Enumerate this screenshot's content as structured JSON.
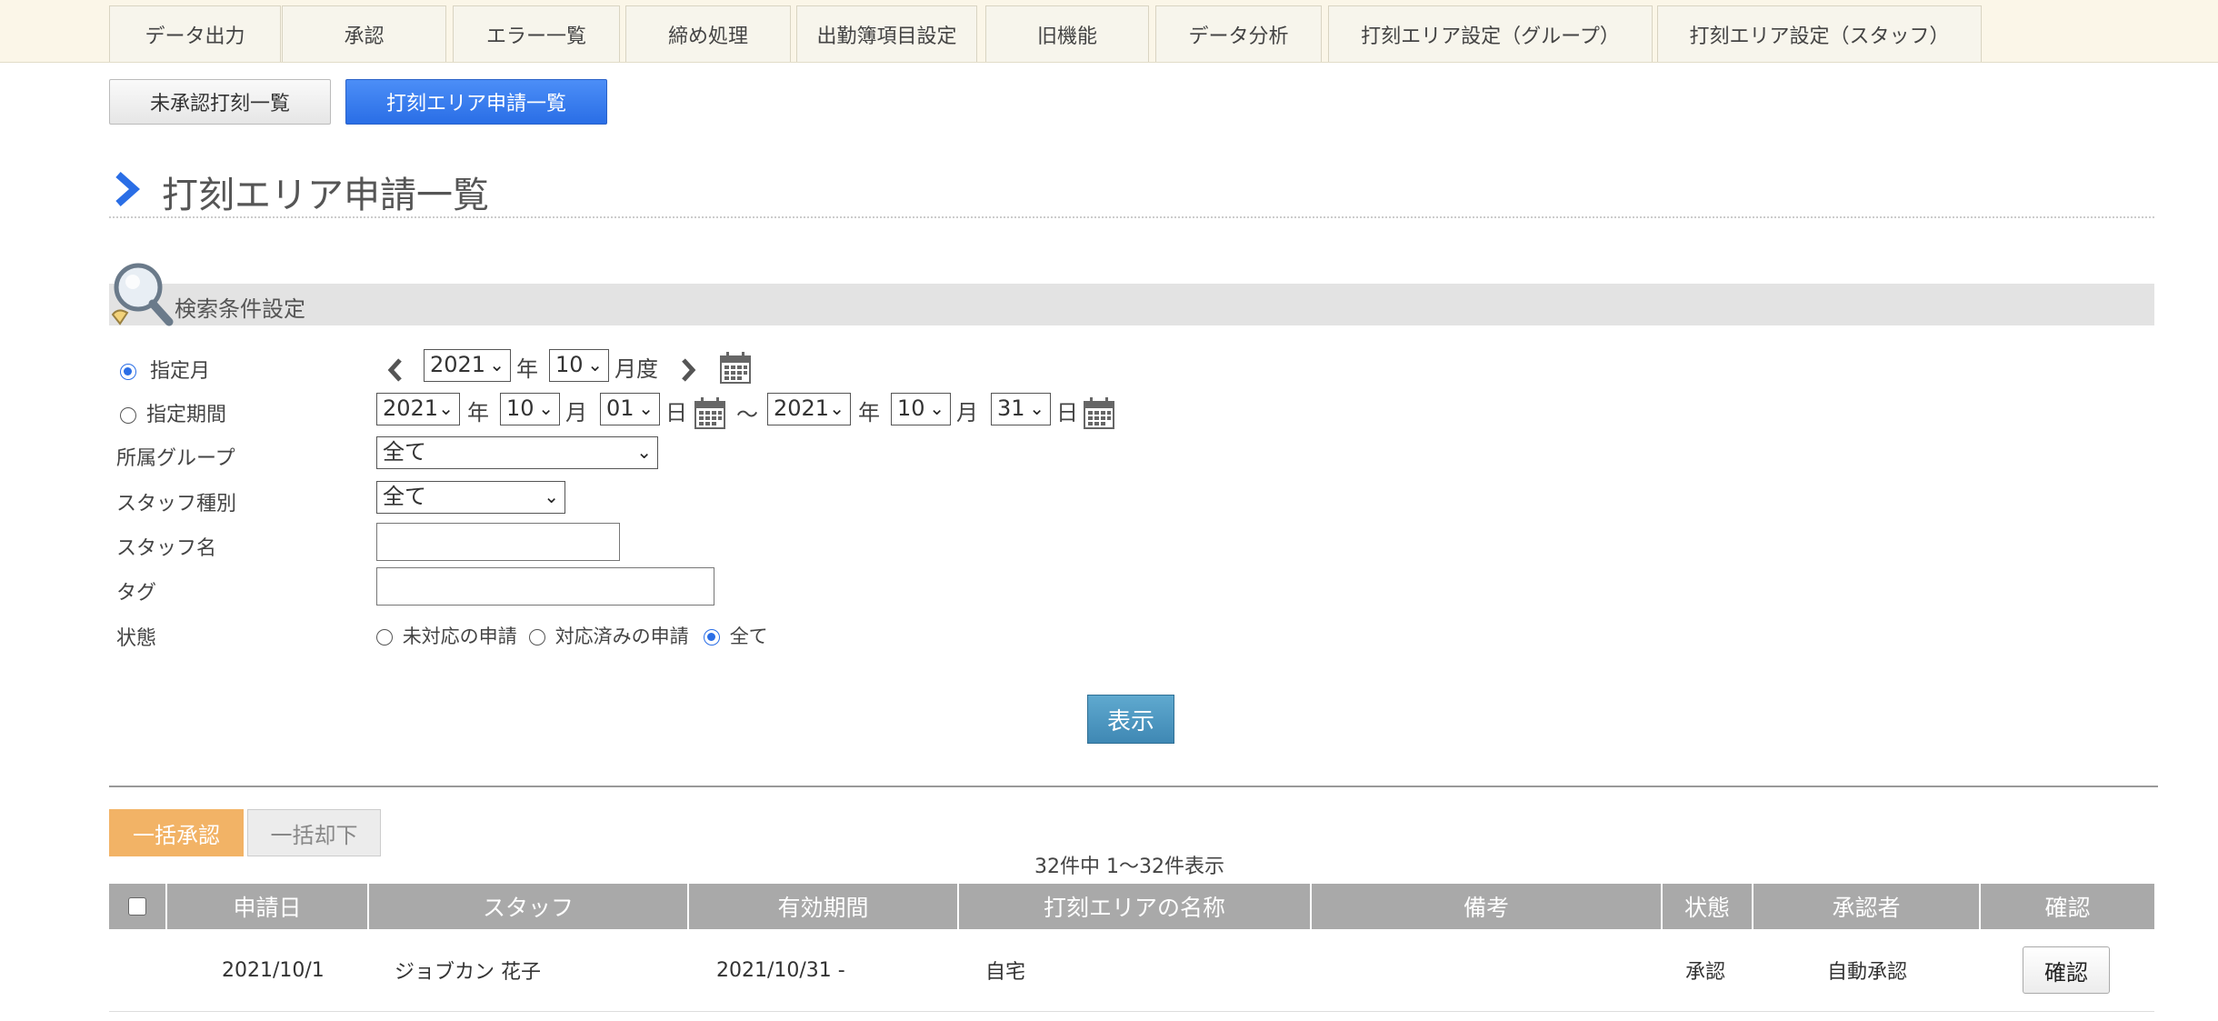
{
  "top_tabs": [
    "データ出力",
    "承認",
    "エラー一覧",
    "締め処理",
    "出勤簿項目設定",
    "旧機能",
    "データ分析",
    "打刻エリア設定（グループ）",
    "打刻エリア設定（スタッフ）"
  ],
  "sub_tabs": {
    "unapproved": "未承認打刻一覧",
    "area_requests": "打刻エリア申請一覧"
  },
  "page_title": "打刻エリア申請一覧",
  "search": {
    "title": "検索条件設定",
    "month_label": "指定月",
    "period_label": "指定期間",
    "month": {
      "year": "2021",
      "year_unit": "年",
      "month": "10",
      "month_unit": "月度"
    },
    "period": {
      "from": {
        "year": "2021",
        "month": "10",
        "day": "01"
      },
      "to": {
        "year": "2021",
        "month": "10",
        "day": "31"
      },
      "year_unit": "年",
      "month_unit": "月",
      "day_unit": "日",
      "tilde": "～"
    },
    "group_label": "所属グループ",
    "group_value": "全て",
    "staff_type_label": "スタッフ種別",
    "staff_type_value": "全て",
    "staff_name_label": "スタッフ名",
    "staff_name_value": "",
    "tag_label": "タグ",
    "tag_value": "",
    "status_label": "状態",
    "status_options": [
      "未対応の申請",
      "対応済みの申請",
      "全て"
    ],
    "status_selected": "全て",
    "show_button": "表示"
  },
  "bulk": {
    "approve": "一括承認",
    "reject": "一括却下"
  },
  "result_count": "32件中 1〜32件表示",
  "table": {
    "headers": [
      "申請日",
      "スタッフ",
      "有効期間",
      "打刻エリアの名称",
      "備考",
      "状態",
      "承認者",
      "確認"
    ],
    "rows": [
      {
        "date": "2021/10/1",
        "staff": "ジョブカン 花子",
        "period": "2021/10/31 -",
        "area": "自宅",
        "note": "",
        "status": "承認",
        "approver": "自動承認",
        "action": "確認"
      }
    ]
  }
}
